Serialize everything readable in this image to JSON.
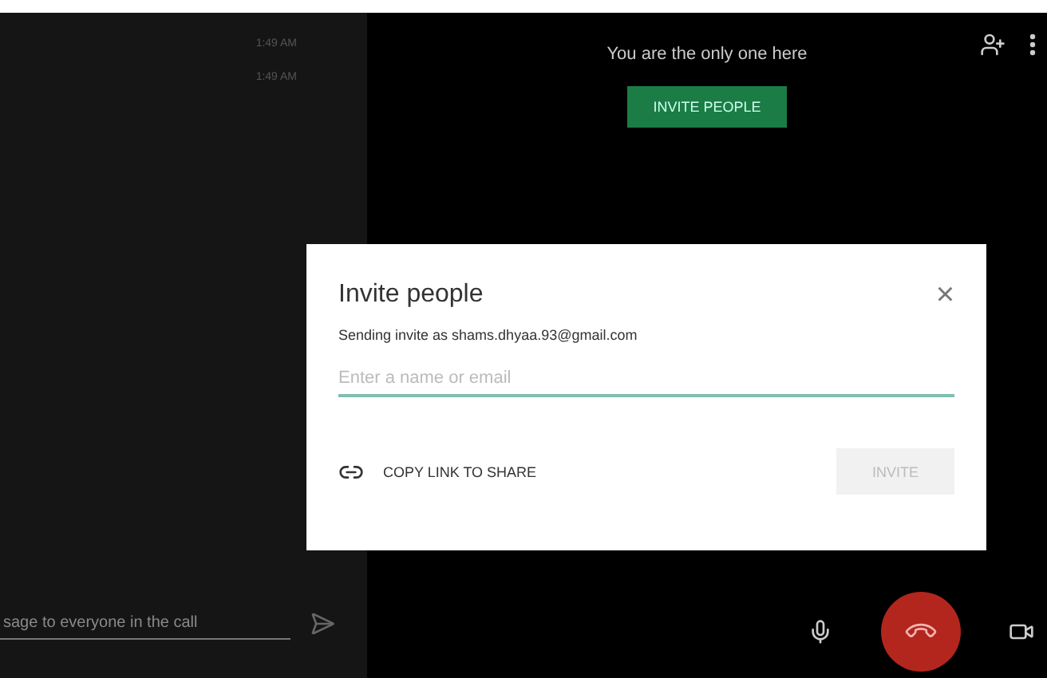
{
  "chat": {
    "messages": [
      {
        "time": "1:49 AM"
      },
      {
        "time": "1:49 AM"
      }
    ],
    "input": {
      "placeholder": "sage to everyone in the call"
    }
  },
  "call": {
    "status": "You are the only one here",
    "invite_button": "INVITE PEOPLE"
  },
  "dialog": {
    "title": "Invite people",
    "close": "×",
    "sender": "Sending invite as shams.dhyaa.93@gmail.com",
    "field": {
      "placeholder": "Enter a name or email"
    },
    "copy_link": "COPY LINK TO SHARE",
    "invite": {
      "label": "INVITE",
      "disabled": true
    }
  }
}
